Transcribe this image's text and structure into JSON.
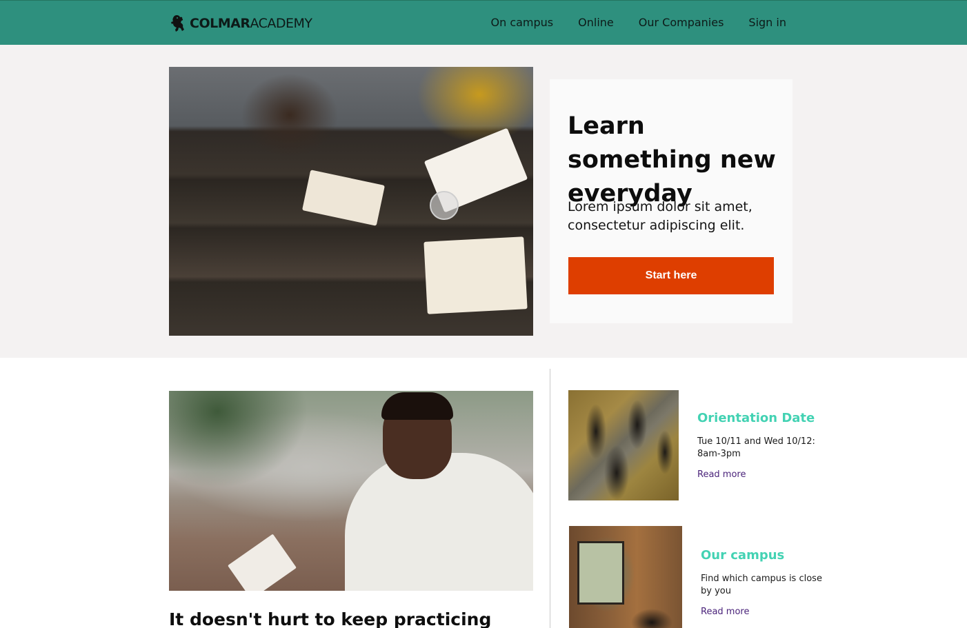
{
  "brand": {
    "name_bold": "COLMAR",
    "name_regular": "ACADEMY",
    "logo_icon": "lion-rampant-icon"
  },
  "nav": {
    "items": [
      {
        "label": "On campus"
      },
      {
        "label": "Online"
      },
      {
        "label": "Our Companies"
      },
      {
        "label": "Sign in"
      }
    ]
  },
  "hero": {
    "title": "Learn something new everyday",
    "subtitle": "Lorem ipsum dolor sit amet, consectetur adipiscing elit.",
    "cta_label": "Start here"
  },
  "article": {
    "title": "It doesn't hurt to keep practicing"
  },
  "events": [
    {
      "title": "Orientation Date",
      "description": "Tue 10/11 and Wed 10/12: 8am-3pm",
      "link_label": "Read more"
    },
    {
      "title": "Our campus",
      "description": "Find which campus is close by you",
      "link_label": "Read more"
    }
  ],
  "colors": {
    "header_bg": "#2e907e",
    "cta_bg": "#de3e00",
    "event_title": "#43d2b3",
    "link": "#4a237a",
    "hero_bg": "#f4f2f2"
  }
}
